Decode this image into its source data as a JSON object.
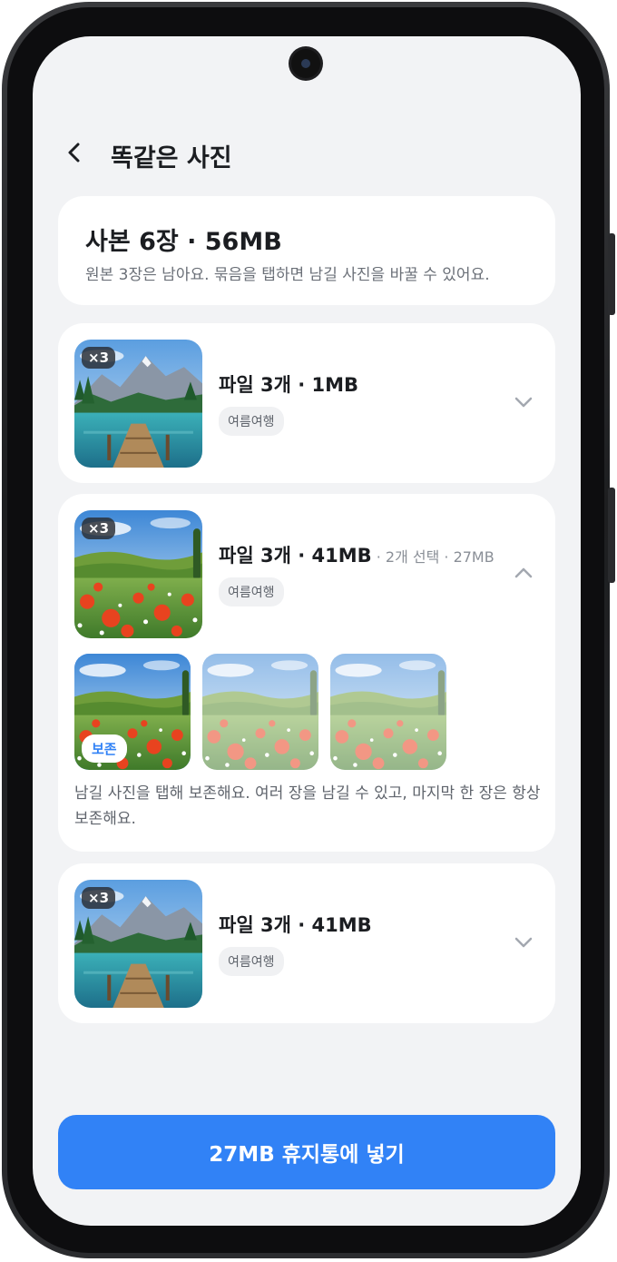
{
  "header": {
    "title": "똑같은 사진",
    "back_icon": "chevron-left-icon"
  },
  "summary": {
    "title": "사본 6장 · 56MB",
    "subtitle": "원본 3장은 남아요. 묶음을 탭하면 남길 사진을 바꿀 수 있어요."
  },
  "groups": [
    {
      "count_badge": "×3",
      "title": "파일 3개 · 1MB",
      "tag": "여름여행",
      "expanded": false,
      "icon": "chevron-down-icon"
    },
    {
      "count_badge": "×3",
      "title": "파일 3개 · 41MB",
      "extra": " · 2개 선택 · 27MB",
      "tag": "여름여행",
      "expanded": true,
      "icon": "chevron-up-icon",
      "photos": [
        {
          "keep_label": "보존",
          "selected_to_keep": true
        },
        {
          "selected_to_keep": false
        },
        {
          "selected_to_keep": false
        }
      ],
      "help": "남길 사진을 탭해 보존해요. 여러 장을 남길 수 있고, 마지막 한 장은 항상 보존해요."
    },
    {
      "count_badge": "×3",
      "title": "파일 3개 · 41MB",
      "tag": "여름여행",
      "expanded": false,
      "icon": "chevron-down-icon"
    }
  ],
  "action": {
    "label": "27MB 휴지통에 넣기"
  },
  "colors": {
    "accent": "#3182f6",
    "background": "#f2f3f5",
    "card": "#ffffff"
  }
}
